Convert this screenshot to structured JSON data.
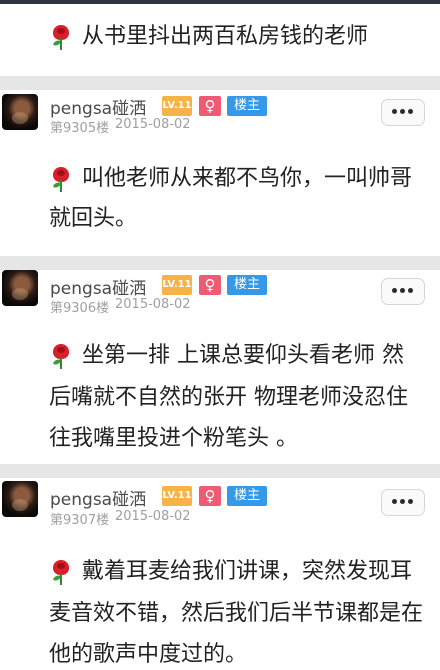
{
  "top_post": {
    "text": "从书里抖出两百私房钱的老师",
    "icon": "rose-emoji"
  },
  "posts": [
    {
      "username": "pengsa碰洒",
      "level": "LV.11",
      "gender": "♀",
      "host_badge": "楼主",
      "floor": "第9305楼",
      "date": "2015-08-02",
      "lines": [
        "叫他老师从来都不鸟你，一叫帅哥",
        "就回头。"
      ]
    },
    {
      "username": "pengsa碰洒",
      "level": "LV.11",
      "gender": "♀",
      "host_badge": "楼主",
      "floor": "第9306楼",
      "date": "2015-08-02",
      "lines": [
        "坐第一排 上课总要仰头看老师 然",
        "后嘴就不自然的张开 物理老师没忍住",
        "往我嘴里投进个粉笔头 。"
      ]
    },
    {
      "username": "pengsa碰洒",
      "level": "LV.11",
      "gender": "♀",
      "host_badge": "楼主",
      "floor": "第9307楼",
      "date": "2015-08-02",
      "lines": [
        "戴着耳麦给我们讲课，突然发现耳",
        "麦音效不错，然后我们后半节课都是在",
        "他的歌声中度过的。"
      ]
    }
  ],
  "colors": {
    "level_badge": "#f7b24a",
    "gender_badge": "#ef5b73",
    "host_badge": "#3599e8",
    "text": "#222222"
  }
}
